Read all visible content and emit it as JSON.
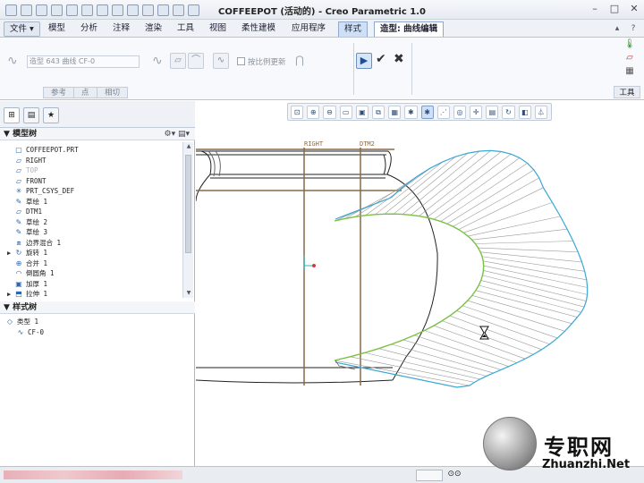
{
  "window": {
    "title": "COFFEEPOT (活动的) - Creo Parametric 1.0"
  },
  "menu": {
    "file": "文件",
    "tabs": [
      "模型",
      "分析",
      "注释",
      "渲染",
      "工具",
      "视图",
      "柔性建模",
      "应用程序"
    ],
    "style_tab": "样式",
    "active_tab": "造型: 曲线编辑"
  },
  "ribbon": {
    "curve_field": "造型 643 曲线 CF-0",
    "proportional_update": "按比例更新",
    "subtabs": [
      "参考",
      "点",
      "相切"
    ],
    "tools_label": "工具",
    "ok_icon": "check-icon",
    "cancel_icon": "cross-icon"
  },
  "model_tree": {
    "header": "模型树",
    "items": [
      {
        "label": "COFFEEPOT.PRT",
        "icon": "part-icon",
        "expand": "",
        "dim": false
      },
      {
        "label": "RIGHT",
        "icon": "datum-plane-icon",
        "expand": "",
        "dim": false
      },
      {
        "label": "TOP",
        "icon": "datum-plane-icon",
        "expand": "",
        "dim": true
      },
      {
        "label": "FRONT",
        "icon": "datum-plane-icon",
        "expand": "",
        "dim": false
      },
      {
        "label": "PRT_CSYS_DEF",
        "icon": "csys-icon",
        "expand": "",
        "dim": false
      },
      {
        "label": "草绘 1",
        "icon": "sketch-icon",
        "expand": "",
        "dim": false
      },
      {
        "label": "DTM1",
        "icon": "datum-plane-icon",
        "expand": "",
        "dim": false
      },
      {
        "label": "草绘 2",
        "icon": "sketch-icon",
        "expand": "",
        "dim": false
      },
      {
        "label": "草绘 3",
        "icon": "sketch-icon",
        "expand": "",
        "dim": false
      },
      {
        "label": "边界混合 1",
        "icon": "boundary-blend-icon",
        "expand": "",
        "dim": false
      },
      {
        "label": "旋转 1",
        "icon": "revolve-icon",
        "expand": "▶",
        "dim": false
      },
      {
        "label": "合并 1",
        "icon": "merge-icon",
        "expand": "",
        "dim": false
      },
      {
        "label": "倒圆角 1",
        "icon": "round-icon",
        "expand": "",
        "dim": false
      },
      {
        "label": "加厚 1",
        "icon": "thicken-icon",
        "expand": "",
        "dim": false
      },
      {
        "label": "拉伸 1",
        "icon": "extrude-icon",
        "expand": "▶",
        "dim": false
      }
    ]
  },
  "style_tree": {
    "header": "样式树",
    "items": [
      {
        "label": "类型 1",
        "icon": "style-icon"
      },
      {
        "label": "CF-0",
        "icon": "curve-icon"
      }
    ]
  },
  "graphics": {
    "datum_labels": [
      "RIGHT",
      "DTM2"
    ]
  },
  "watermark": {
    "cn": "专职网",
    "en": "Zhuanzhi.Net"
  },
  "colors": {
    "datum": "#8a6a48",
    "curve_green": "#7ac142",
    "curve_blue": "#3aa7d6",
    "selection": "#cfe0f6"
  }
}
